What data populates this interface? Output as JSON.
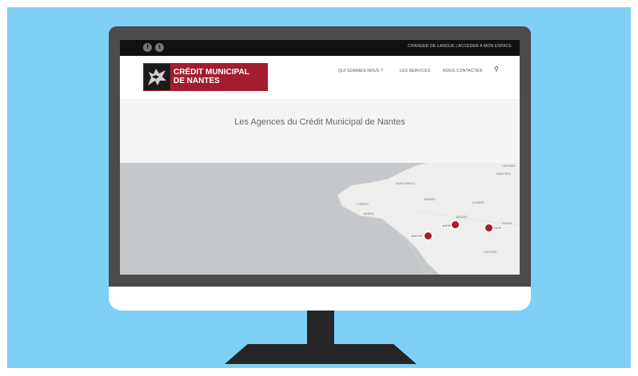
{
  "colors": {
    "background": "#7fd0f5",
    "brand": "#a31d2e",
    "topbar": "#111111",
    "map_water": "#c5c9cb",
    "map_land": "#eeeeec"
  },
  "topbar": {
    "social_icons": [
      "facebook-icon",
      "twitter-icon"
    ],
    "facebook_glyph": "f",
    "twitter_glyph": "t",
    "links_text": "CHANGER DE LANGUE | ACCEDER A MON ESPACE"
  },
  "logo": {
    "line1": "CRÉDIT MUNICIPAL",
    "line2": "DE NANTES"
  },
  "nav": {
    "items": [
      "QUI SOMMES-NOUS ?",
      "LES SERVICES",
      "NOUS CONTACTER"
    ],
    "search_icon": "search-icon",
    "search_glyph": "⚲"
  },
  "hero": {
    "title": "Les Agences du Crédit Municipal de Nantes"
  },
  "map": {
    "city_labels": [
      "SAINT-BRIEUC",
      "RENNES",
      "LE MANS",
      "LORIENT",
      "VANNES",
      "ANGERS",
      "TOURS",
      "POITIERS",
      "ORLÉANS",
      "CHARTRES"
    ],
    "pins": [
      {
        "label": "NANTES",
        "count": "1"
      },
      {
        "label": "ANGERS",
        "count": "1"
      },
      {
        "label": "TOURS",
        "count": "1"
      }
    ]
  }
}
